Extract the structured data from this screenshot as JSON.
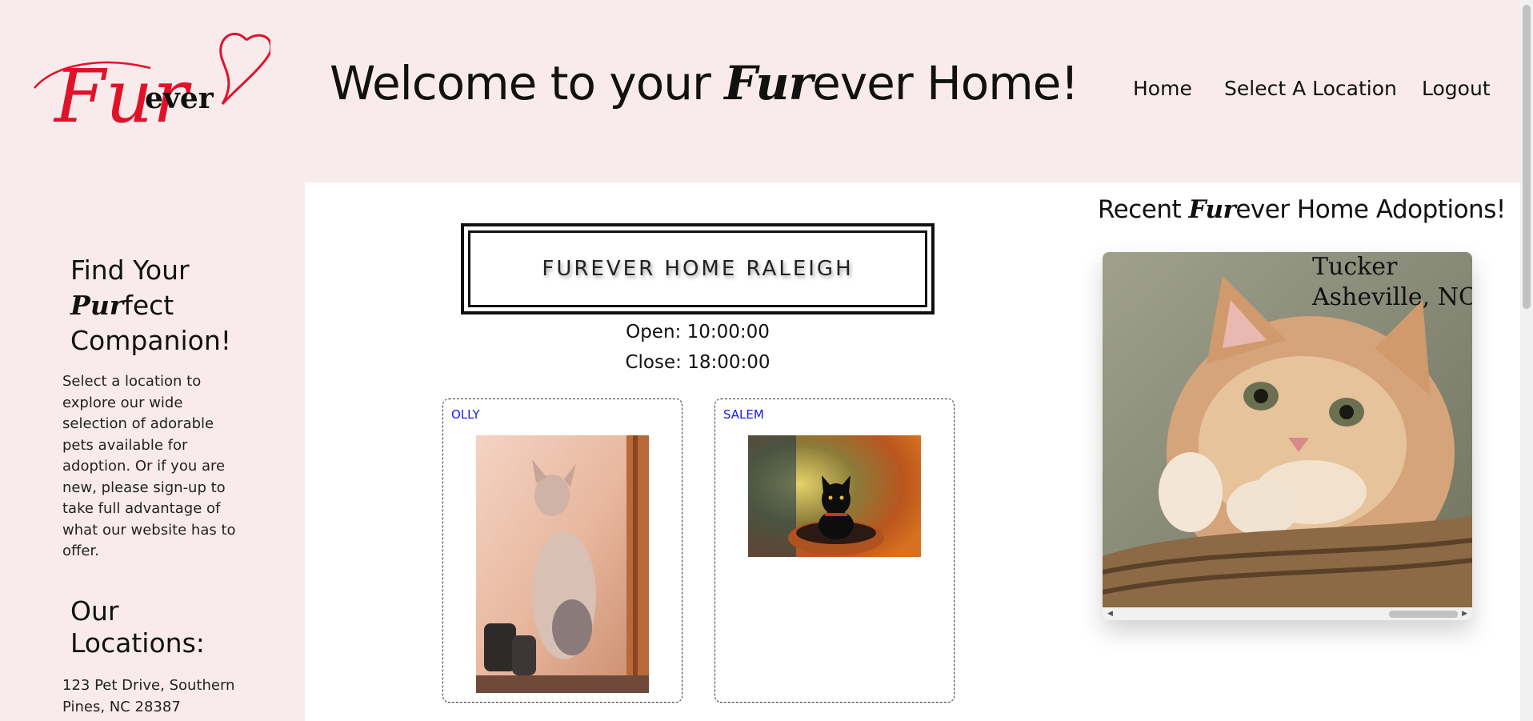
{
  "header": {
    "logo_text": {
      "fur": "Fur",
      "ever": "ever"
    },
    "welcome": {
      "before": "Welcome to your ",
      "fur": "Fur",
      "after": "ever Home!"
    },
    "nav": {
      "home": "Home",
      "select_location": "Select A Location",
      "logout": "Logout"
    }
  },
  "sidebar": {
    "heading1": {
      "line1": "Find Your",
      "pur": "Pur",
      "line2_rest": "fect",
      "line3": "Companion!"
    },
    "intro": "Select a location to explore our wide selection of adorable pets available for adoption. Or if you are new, please sign-up to take full advantage of what our website has to offer.",
    "heading2": "Our Locations:",
    "address": "123 Pet Drive, Southern Pines, NC 28387"
  },
  "location": {
    "title": "FUREVER HOME RALEIGH",
    "open": "Open: 10:00:00",
    "close": "Close: 18:00:00"
  },
  "pets": [
    {
      "name": "OLLY",
      "image": "sphynx-cat-photo"
    },
    {
      "name": "SALEM",
      "image": "black-cat-photo"
    }
  ],
  "recent": {
    "title": {
      "before": "Recent ",
      "fur": "Fur",
      "after": "ever Home Adoptions!"
    },
    "adoption": {
      "name": "Tucker",
      "place": "Asheville, NC",
      "image": "orange-cat-photo"
    }
  },
  "colors": {
    "header_bg": "#f9ebeb",
    "logo_red": "#e0122a",
    "link_blue": "#1a1ae6"
  }
}
